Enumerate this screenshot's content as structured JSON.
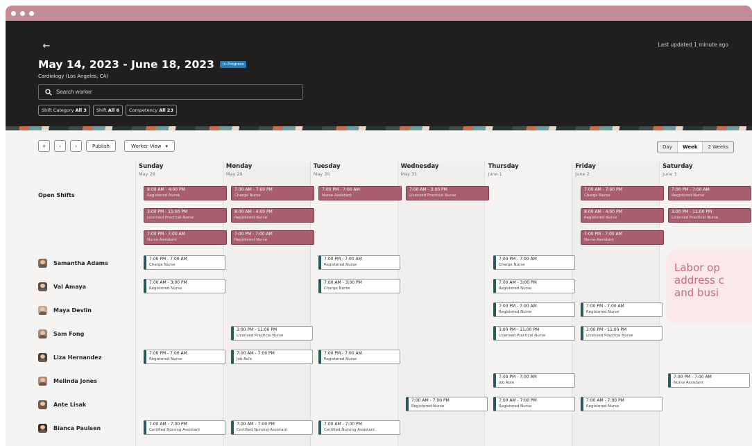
{
  "header": {
    "last_updated": "Last updated 1 minute ago",
    "title": "May 14, 2023 - June 18, 2023",
    "status_badge": "In-Progress",
    "subtitle": "Cardiology (Los Angeles, CA)",
    "search_placeholder": "Search worker",
    "filters": [
      {
        "label": "Shift Category",
        "value": "All 3"
      },
      {
        "label": "Shift",
        "value": "All 6"
      },
      {
        "label": "Competency",
        "value": "All 23"
      }
    ]
  },
  "toolbar": {
    "publish": "Publish",
    "view_select": "Worker View",
    "range_options": [
      "Day",
      "Week",
      "2 Weeks"
    ],
    "active_range": "Week"
  },
  "days": [
    {
      "name": "Sunday",
      "date": "May 28"
    },
    {
      "name": "Monday",
      "date": "May 29"
    },
    {
      "name": "Tuesday",
      "date": "May 30"
    },
    {
      "name": "Wednesday",
      "date": "May 31"
    },
    {
      "name": "Thursday",
      "date": "June 1"
    },
    {
      "name": "Friday",
      "date": "June 2"
    },
    {
      "name": "Saturday",
      "date": "June 3"
    }
  ],
  "rows": {
    "open_shifts": "Open Shifts",
    "workers": [
      "Samantha Adams",
      "Val Amaya",
      "Maya Devlin",
      "Sam Fong",
      "Liza Hernandez",
      "Melinda Jones",
      "Ante Lisak",
      "Bianca Paulsen"
    ]
  },
  "open_shifts": [
    {
      "day": 0,
      "slot": 0,
      "time": "8:00 AM - 4:00 PM",
      "role": "Registered Nurse"
    },
    {
      "day": 0,
      "slot": 1,
      "time": "3:00 PM - 11:00 PM",
      "role": "Licensed Practical Nurse"
    },
    {
      "day": 0,
      "slot": 2,
      "time": "7:00 PM - 7:00 AM",
      "role": "Nurse Assistant"
    },
    {
      "day": 1,
      "slot": 0,
      "time": "7:00 AM - 7:00 PM",
      "role": "Charge Nurse"
    },
    {
      "day": 1,
      "slot": 1,
      "time": "8:00 AM - 4:00 PM",
      "role": "Registered Nurse"
    },
    {
      "day": 1,
      "slot": 2,
      "time": "7:00 PM - 7:00 AM",
      "role": "Registered Nurse"
    },
    {
      "day": 2,
      "slot": 0,
      "time": "7:00 PM - 7:00 AM",
      "role": "Nurse Assistant"
    },
    {
      "day": 3,
      "slot": 0,
      "time": "7:00 AM - 3:00 PM",
      "role": "Licensed Practical Nurse"
    },
    {
      "day": 5,
      "slot": 0,
      "time": "7:00 AM - 7:00 PM",
      "role": "Charge Nurse"
    },
    {
      "day": 5,
      "slot": 1,
      "time": "8:00 AM - 4:00 PM",
      "role": "Registered Nurse"
    },
    {
      "day": 5,
      "slot": 2,
      "time": "7:00 PM - 7:00 AM",
      "role": "Nurse Assistant"
    },
    {
      "day": 6,
      "slot": 0,
      "time": "7:00 PM - 7:00 AM",
      "role": "Registered Nurse"
    },
    {
      "day": 6,
      "slot": 1,
      "time": "3:00 PM - 11:00 PM",
      "role": "Licensed Practical Nurse"
    }
  ],
  "assigned_shifts": [
    {
      "worker": 0,
      "day": 0,
      "time": "7:00 PM - 7:00 AM",
      "role": "Charge Nurse"
    },
    {
      "worker": 0,
      "day": 2,
      "time": "7:00 PM - 7:00 AM",
      "role": "Registered Nurse"
    },
    {
      "worker": 0,
      "day": 4,
      "time": "7:00 PM - 7:00 AM",
      "role": "Charge Nurse"
    },
    {
      "worker": 1,
      "day": 0,
      "time": "7:00 AM - 3:00 PM",
      "role": "Registered Nurse"
    },
    {
      "worker": 1,
      "day": 2,
      "time": "7:00 AM - 3:00 PM",
      "role": "Charge Nurse"
    },
    {
      "worker": 1,
      "day": 4,
      "time": "7:00 AM - 3:00 PM",
      "role": "Registered Nurse"
    },
    {
      "worker": 2,
      "day": 4,
      "time": "7:00 PM - 7:00 AM",
      "role": "Registered Nurse"
    },
    {
      "worker": 2,
      "day": 5,
      "time": "7:00 PM - 7:00 AM",
      "role": "Registered Nurse"
    },
    {
      "worker": 3,
      "day": 1,
      "time": "3:00 PM - 11:00 PM",
      "role": "Licensed Practical Nurse"
    },
    {
      "worker": 3,
      "day": 4,
      "time": "3:00 PM - 11:00 PM",
      "role": "Licensed Practical Nurse"
    },
    {
      "worker": 3,
      "day": 5,
      "time": "3:00 PM - 11:00 PM",
      "role": "Licensed Practical Nurse"
    },
    {
      "worker": 4,
      "day": 0,
      "time": "7:00 PM - 7:00 AM",
      "role": "Registered Nurse"
    },
    {
      "worker": 4,
      "day": 1,
      "time": "7:00 AM - 7:00 PM",
      "role": "Job Role"
    },
    {
      "worker": 4,
      "day": 2,
      "time": "7:00 PM - 7:00 AM",
      "role": "Registered Nurse"
    },
    {
      "worker": 5,
      "day": 4,
      "time": "7:00 PM - 7:00 AM",
      "role": "Job Role"
    },
    {
      "worker": 5,
      "day": 6,
      "time": "7:00 PM - 7:00 AM",
      "role": "Nurse Assistant"
    },
    {
      "worker": 6,
      "day": 3,
      "time": "7:00 AM - 7:00 PM",
      "role": "Registered Nurse"
    },
    {
      "worker": 6,
      "day": 4,
      "time": "7:00 AM - 7:00 PM",
      "role": "Registered Nurse"
    },
    {
      "worker": 6,
      "day": 5,
      "time": "7:00 AM - 7:00 PM",
      "role": "Registered Nurse"
    },
    {
      "worker": 7,
      "day": 0,
      "time": "7:00 AM - 7:00 PM",
      "role": "Certified Nursing Assistant"
    },
    {
      "worker": 7,
      "day": 1,
      "time": "7:00 AM - 7:00 PM",
      "role": "Certified Nursing Assistant"
    },
    {
      "worker": 7,
      "day": 2,
      "time": "7:00 AM - 7:00 PM",
      "role": "Certified Nursing Assistant"
    }
  ],
  "callout": {
    "lines": [
      "Labor op",
      "address c",
      "and busi"
    ]
  },
  "colors": {
    "open_shift": "#a95e6e",
    "assigned_accent": "#2b5a5d",
    "titlebar": "#c48a96",
    "badge": "#2a7bb6"
  }
}
